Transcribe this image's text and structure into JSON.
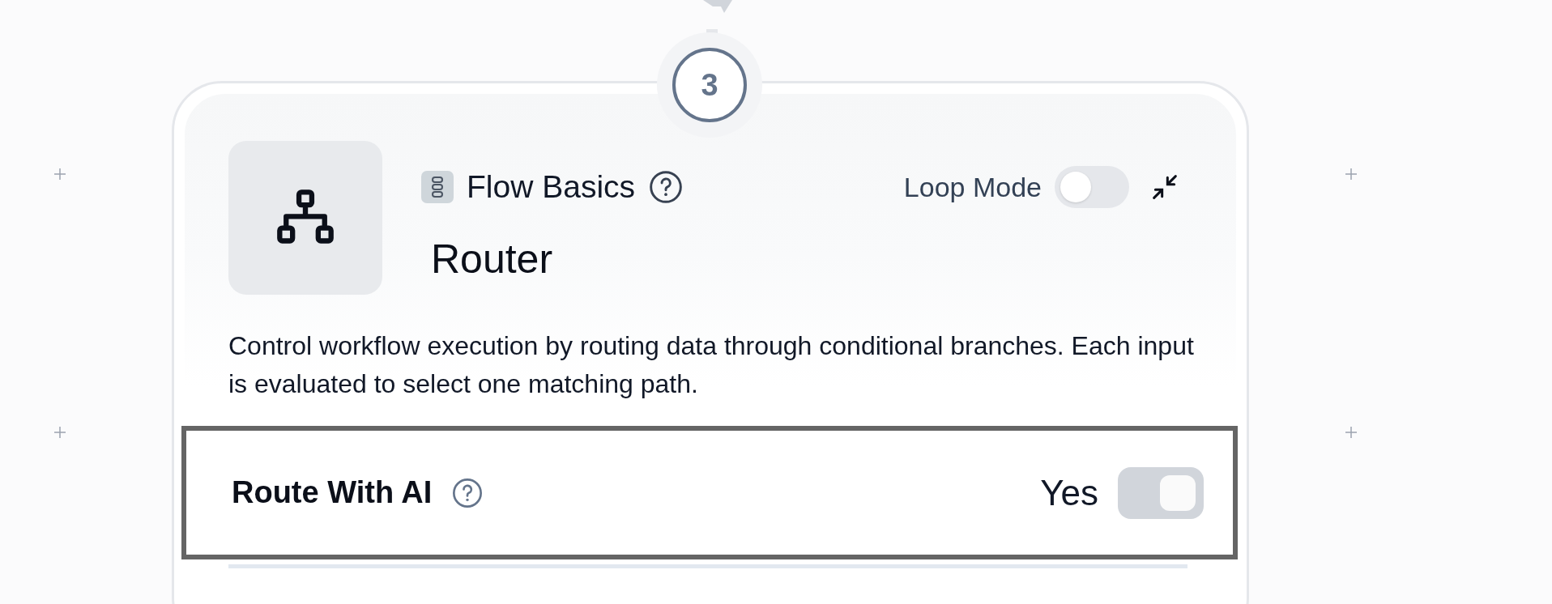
{
  "step": "3",
  "node": {
    "category": "Flow Basics",
    "title": "Router",
    "description": "Control workflow execution by routing data through conditional branches. Each input is evaluated to select one matching path."
  },
  "loop_mode": {
    "label": "Loop Mode",
    "on": false
  },
  "settings": [
    {
      "label": "Route With AI",
      "value": "Yes",
      "on": true,
      "focused": true
    }
  ]
}
